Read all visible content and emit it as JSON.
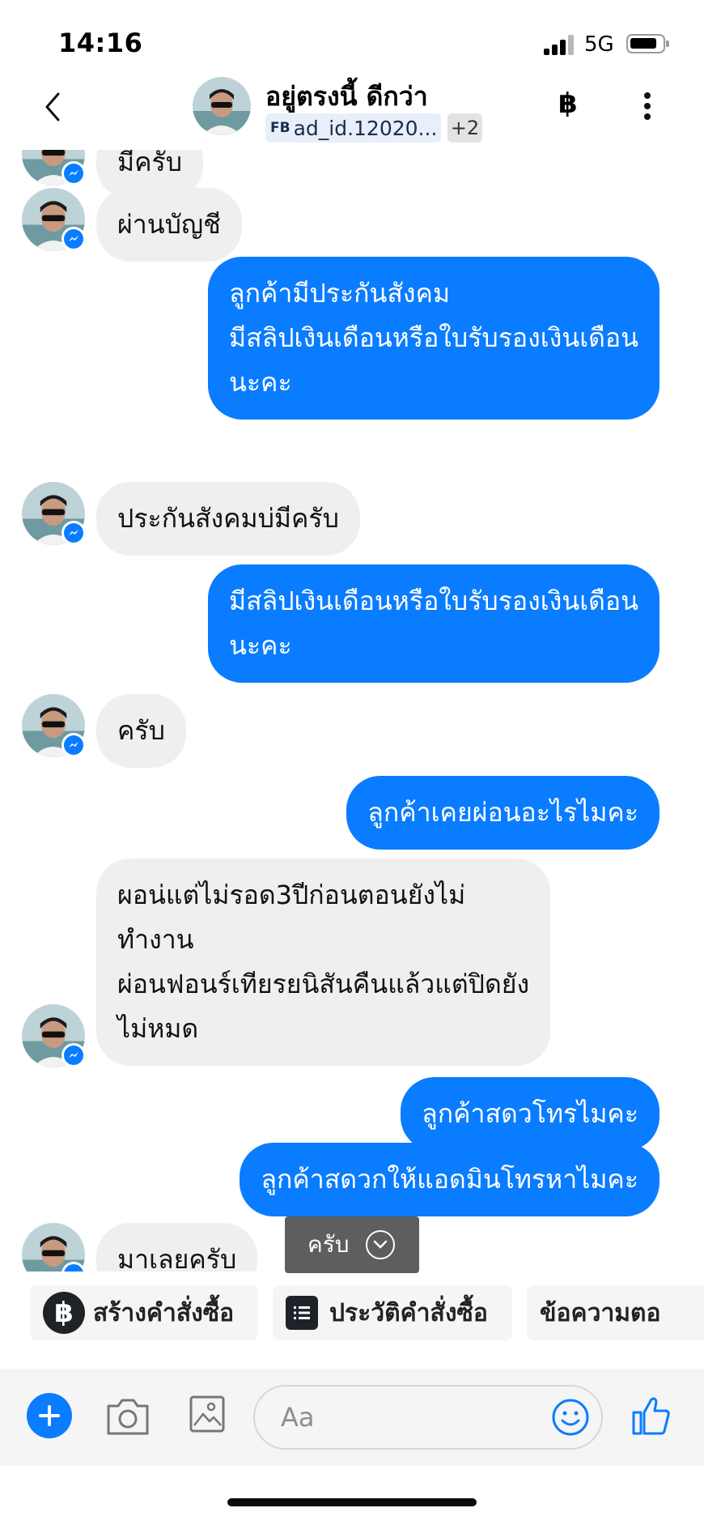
{
  "status_bar": {
    "time": "14:16",
    "network": "5G"
  },
  "header": {
    "contact_name": "อยู่ตรงนี้ ดีกว่า",
    "ad_tag_prefix": "FB",
    "ad_tag": "ad_id.12020...",
    "more_tags": "+2",
    "currency_symbol": "฿",
    "icons": [
      "back-icon",
      "baht-icon",
      "more-icon"
    ]
  },
  "messages": [
    {
      "direction": "in",
      "lines": [
        "มีครับ"
      ]
    },
    {
      "direction": "in",
      "lines": [
        "ผ่านบัญชี"
      ]
    },
    {
      "direction": "out",
      "lines": [
        "ลูกค้ามีประกันสังคม",
        "มีสลิปเงินเดือนหรือใบรับรองเงินเดือน",
        "นะคะ"
      ]
    },
    {
      "direction": "in",
      "lines": [
        "ประกันสังคมบ่มีครับ"
      ]
    },
    {
      "direction": "out",
      "lines": [
        "มีสลิปเงินเดือนหรือใบรับรองเงินเดือน",
        "นะคะ"
      ]
    },
    {
      "direction": "in",
      "lines": [
        "ครับ"
      ]
    },
    {
      "direction": "out",
      "lines": [
        "ลูกค้าเคยผ่อนอะไรไมคะ"
      ]
    },
    {
      "direction": "in",
      "lines": [
        "ผอน่แต่ไม่รอด3ปีก่อนตอนยังไม่",
        "ทำงาน",
        "ผ่อนฟอนร์เทียรยนิสันคืนแล้วแต่ปิดยัง",
        "ไม่หมด"
      ]
    },
    {
      "direction": "out",
      "lines": [
        "ลูกค้าสดวโทรไมคะ"
      ]
    },
    {
      "direction": "out",
      "lines": [
        "ลูกค้าสดวกให้แอดมินโทรหาไมคะ"
      ]
    },
    {
      "direction": "in",
      "lines": [
        "มาเลยครับ"
      ]
    }
  ],
  "reply_chip": {
    "label": "ครับ"
  },
  "quick_actions": [
    {
      "label": "สร้างคำสั่งซื้อ",
      "icon": "baht-icon",
      "glyph": "฿"
    },
    {
      "label": "ประวัติคำสั่งซื้อ",
      "icon": "order-history-icon"
    },
    {
      "label": "ข้อความตอ",
      "icon": "chat-bubbles-icon"
    }
  ],
  "composer": {
    "placeholder": "Aa",
    "icons": [
      "plus-icon",
      "camera-icon",
      "gallery-icon",
      "emoji-icon",
      "thumbs-up-icon"
    ]
  },
  "colors": {
    "accent": "#0a7cff",
    "incoming_bubble": "#efefef",
    "dark_icon": "#1f2329"
  }
}
